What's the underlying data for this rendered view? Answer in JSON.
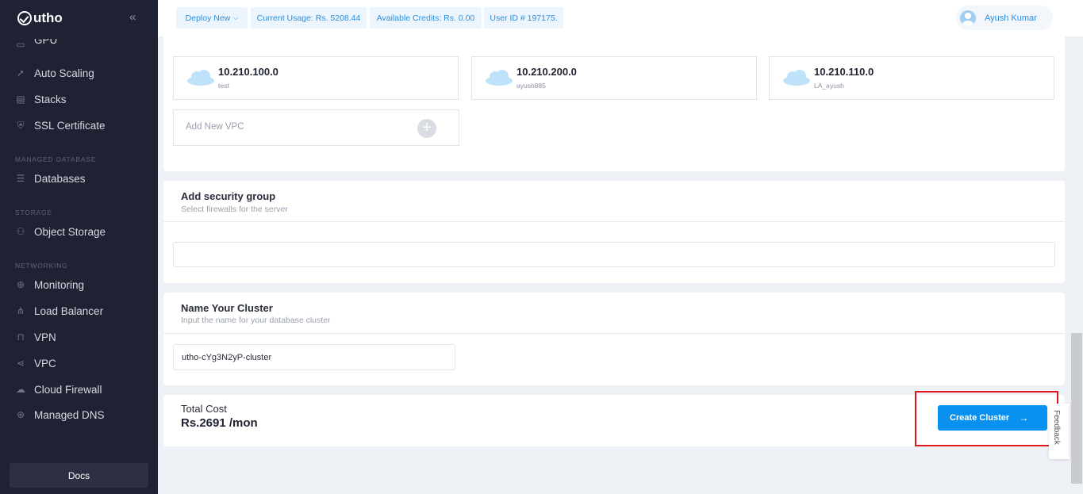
{
  "sidebar": {
    "logo": "utho",
    "items": [
      {
        "label": "GPU"
      },
      {
        "label": "Auto Scaling"
      },
      {
        "label": "Stacks"
      },
      {
        "label": "SSL Certificate"
      },
      {
        "label": "Databases"
      },
      {
        "label": "Object Storage"
      },
      {
        "label": "Monitoring"
      },
      {
        "label": "Load Balancer"
      },
      {
        "label": "VPN"
      },
      {
        "label": "VPC"
      },
      {
        "label": "Cloud Firewall"
      },
      {
        "label": "Managed DNS"
      }
    ],
    "sections": {
      "managed_database": "MANAGED DATABASE",
      "storage": "STORAGE",
      "networking": "NETWORKING"
    },
    "docs": "Docs"
  },
  "topbar": {
    "deploy_new": "Deploy New",
    "current_usage": "Current Usage: Rs. 5208.44",
    "available_credits": "Available Credits: Rs. 0.00",
    "user_id": "User ID # 197175.",
    "user_name": "Ayush Kumar"
  },
  "vpc": {
    "items": [
      {
        "ip": "10.210.100.0",
        "name": "test"
      },
      {
        "ip": "10.210.200.0",
        "name": "ayush885"
      },
      {
        "ip": "10.210.110.0",
        "name": "LA_ayush"
      }
    ],
    "add_label": "Add New VPC"
  },
  "security_group": {
    "title": "Add security group",
    "subtitle": "Select firewalls for the server",
    "value": ""
  },
  "cluster_name": {
    "title": "Name Your Cluster",
    "subtitle": "Input the name for your database cluster",
    "value": "utho-cYg3N2yP-cluster"
  },
  "total": {
    "label": "Total Cost",
    "amount": "Rs.2691 /mon"
  },
  "create_button": "Create Cluster",
  "feedback": "Feedback",
  "colors": {
    "accent": "#0a91f0",
    "sidebar": "#1f2232",
    "highlight": "#e0161b"
  }
}
